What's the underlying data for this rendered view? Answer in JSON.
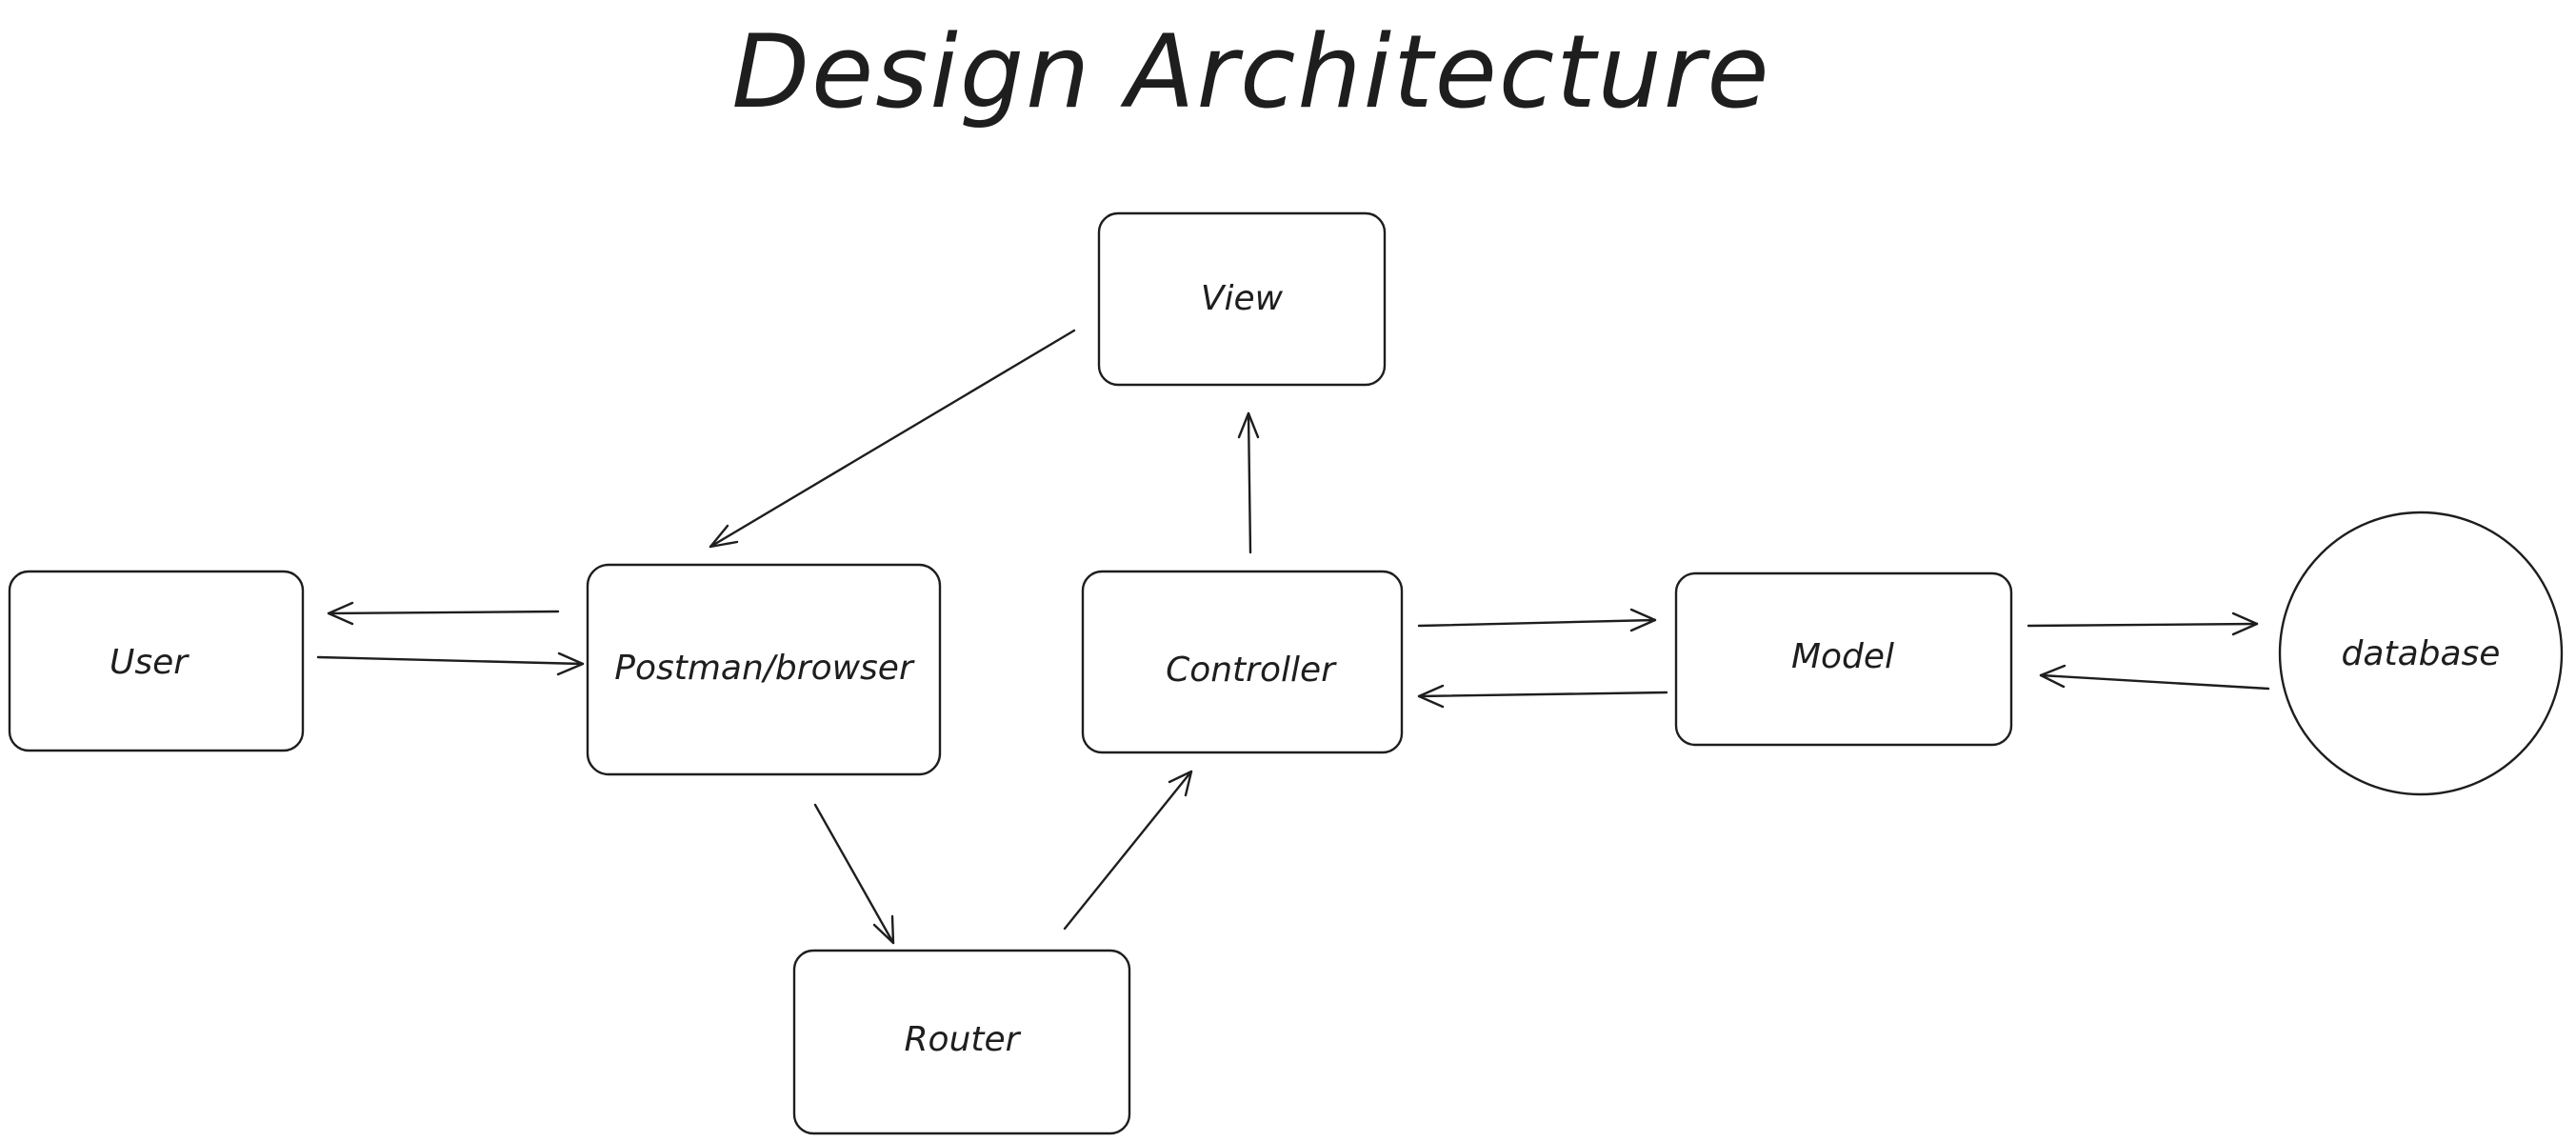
{
  "title": "Design Architecture",
  "colors": {
    "stroke": "#1e1e1e",
    "background": "#ffffff"
  },
  "nodes": {
    "view": {
      "label": "View",
      "shape": "rounded-rectangle"
    },
    "user": {
      "label": "User",
      "shape": "rounded-rectangle"
    },
    "postman": {
      "label": "Postman/browser",
      "shape": "rounded-rectangle"
    },
    "controller": {
      "label": "Controller",
      "shape": "rounded-rectangle"
    },
    "model": {
      "label": "Model",
      "shape": "rounded-rectangle"
    },
    "database": {
      "label": "database",
      "shape": "circle"
    },
    "router": {
      "label": "Router",
      "shape": "rounded-rectangle"
    }
  },
  "edges": [
    {
      "from": "view",
      "to": "postman"
    },
    {
      "from": "postman",
      "to": "user"
    },
    {
      "from": "user",
      "to": "postman"
    },
    {
      "from": "postman",
      "to": "router"
    },
    {
      "from": "router",
      "to": "controller"
    },
    {
      "from": "controller",
      "to": "view"
    },
    {
      "from": "controller",
      "to": "model"
    },
    {
      "from": "model",
      "to": "controller"
    },
    {
      "from": "model",
      "to": "database"
    },
    {
      "from": "database",
      "to": "model"
    }
  ]
}
